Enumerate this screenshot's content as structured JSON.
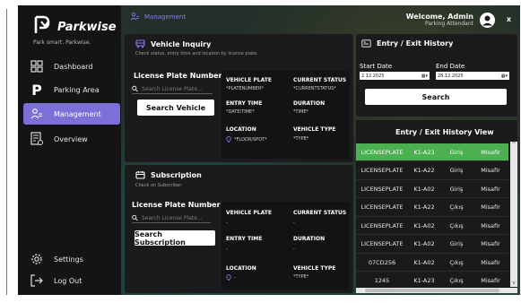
{
  "app": {
    "name": "Parkwise",
    "tagline": "Park smart. Parkwise."
  },
  "sidebar": {
    "items": [
      {
        "label": "Dashboard",
        "icon": "dashboard-icon"
      },
      {
        "label": "Parking Area",
        "icon": "parking-p-icon"
      },
      {
        "label": "Management",
        "icon": "users-icon",
        "active": true
      },
      {
        "label": "Overview",
        "icon": "overview-report-icon"
      }
    ],
    "bottom": [
      {
        "label": "Settings",
        "icon": "gear-icon"
      },
      {
        "label": "Log Out",
        "icon": "logout-icon"
      }
    ]
  },
  "topbar": {
    "breadcrumb": "Management",
    "welcome": "Welcome, Admin",
    "role": "Parking Attendant",
    "close": "x"
  },
  "vehicle_inquiry": {
    "title": "Vehicle Inquiry",
    "subtitle": "Check status, entry time and location by license plate.",
    "field_label": "License Plate Number",
    "placeholder": "Search License Plate...",
    "button": "Search Vehicle",
    "info": {
      "plate_h": "VEHICLE PLATE",
      "plate_v": "*PLATENUMBER*",
      "status_h": "CURRENT STATUS",
      "status_v": "*CURRENTSTATUS*",
      "entry_h": "ENTRY TIME",
      "entry_v": "*DATE/TIME*",
      "duration_h": "DURATION",
      "duration_v": "*TIME*",
      "location_h": "LOCATION",
      "location_v": "*FLOOR/SPOT*",
      "type_h": "VEHICLE TYPE",
      "type_v": "*TYPE*"
    }
  },
  "subscription": {
    "title": "Subscription",
    "subtitle": "Check on Subscriber",
    "field_label": "License Plate Number",
    "placeholder": "Search License Plate...",
    "button": "Search Subscription",
    "info": {
      "plate_h": "VEHICLE PLATE",
      "plate_v": "-",
      "status_h": "CURRENT STATUS",
      "status_v": "-",
      "entry_h": "ENTRY TIME",
      "entry_v": "-",
      "duration_h": "DURATION",
      "duration_v": "-",
      "location_h": "LOCATION",
      "location_v": "-",
      "type_h": "VEHICLE TYPE",
      "type_v": "*TYPE*"
    }
  },
  "history": {
    "title": "Entry / Exit History",
    "start_label": "Start Date",
    "start_value": "2.12.2025",
    "end_label": "End Date",
    "end_value": "28.12.2025",
    "button": "Search",
    "view_title": "Entry / Exit History View",
    "rows": [
      {
        "plate": "LICENSEPLATE",
        "spot": "K1-A23",
        "dir": "Giriş",
        "type": "Misafir",
        "highlight": true
      },
      {
        "plate": "LICENSEPLATE",
        "spot": "K1-A22",
        "dir": "Giriş",
        "type": "Misafir"
      },
      {
        "plate": "LICENSEPLATE",
        "spot": "K1-A02",
        "dir": "Giriş",
        "type": "Misafir"
      },
      {
        "plate": "LICENSEPLATE",
        "spot": "K1-A22",
        "dir": "Çıkış",
        "type": "Misafir"
      },
      {
        "plate": "LICENSEPLATE",
        "spot": "K1-A02",
        "dir": "Çıkış",
        "type": "Misafir"
      },
      {
        "plate": "LICENSEPLATE",
        "spot": "K1-A02",
        "dir": "Giriş",
        "type": "Misafir"
      },
      {
        "plate": "07CD256",
        "spot": "K1-A02",
        "dir": "Çıkış",
        "type": "Misafir"
      },
      {
        "plate": "1245",
        "spot": "K1-A23",
        "dir": "Çıkış",
        "type": "Misafir"
      }
    ]
  },
  "colors": {
    "accent": "#7c6fd6",
    "highlight_row": "#4caf50",
    "panel": "#1b1b1d",
    "sidebar": "#141416"
  }
}
